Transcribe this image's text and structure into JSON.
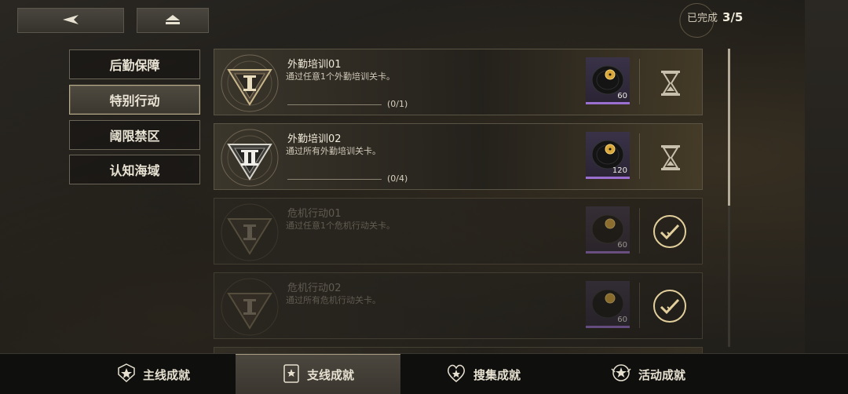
{
  "header": {
    "back_icon": "back-arrow-icon",
    "home_icon": "home-icon",
    "progress_label": "已完成",
    "progress_count": "3/5"
  },
  "categories": [
    {
      "label": "后勤保障",
      "active": false
    },
    {
      "label": "特别行动",
      "active": true
    },
    {
      "label": "阈限禁区",
      "active": false
    },
    {
      "label": "认知海域",
      "active": false
    }
  ],
  "achievements": [
    {
      "title": "外勤培训01",
      "desc": "通过任意1个外勤培训关卡。",
      "progress": "(0/1)",
      "reward_qty": "60",
      "status": "in-progress",
      "status_icon": "hourglass-icon",
      "emblem": "rank-I-emblem-icon"
    },
    {
      "title": "外勤培训02",
      "desc": "通过所有外勤培训关卡。",
      "progress": "(0/4)",
      "reward_qty": "120",
      "status": "in-progress",
      "status_icon": "hourglass-icon",
      "emblem": "rank-II-emblem-icon"
    },
    {
      "title": "危机行动01",
      "desc": "通过任意1个危机行动关卡。",
      "progress": "",
      "reward_qty": "60",
      "status": "completed",
      "status_icon": "checkmark-icon",
      "emblem": "rank-I-emblem-icon"
    },
    {
      "title": "危机行动02",
      "desc": "通过所有危机行动关卡。",
      "progress": "",
      "reward_qty": "60",
      "status": "completed",
      "status_icon": "checkmark-icon",
      "emblem": "rank-I-emblem-icon"
    }
  ],
  "bottom_tabs": [
    {
      "label": "主线成就",
      "active": false,
      "icon": "main-achievement-icon"
    },
    {
      "label": "支线成就",
      "active": true,
      "icon": "side-achievement-icon"
    },
    {
      "label": "搜集成就",
      "active": false,
      "icon": "collection-achievement-icon"
    },
    {
      "label": "活动成就",
      "active": false,
      "icon": "event-achievement-icon"
    }
  ],
  "colors": {
    "accent_gold": "#d9c08a",
    "reward_purple": "#9b6fd0"
  }
}
